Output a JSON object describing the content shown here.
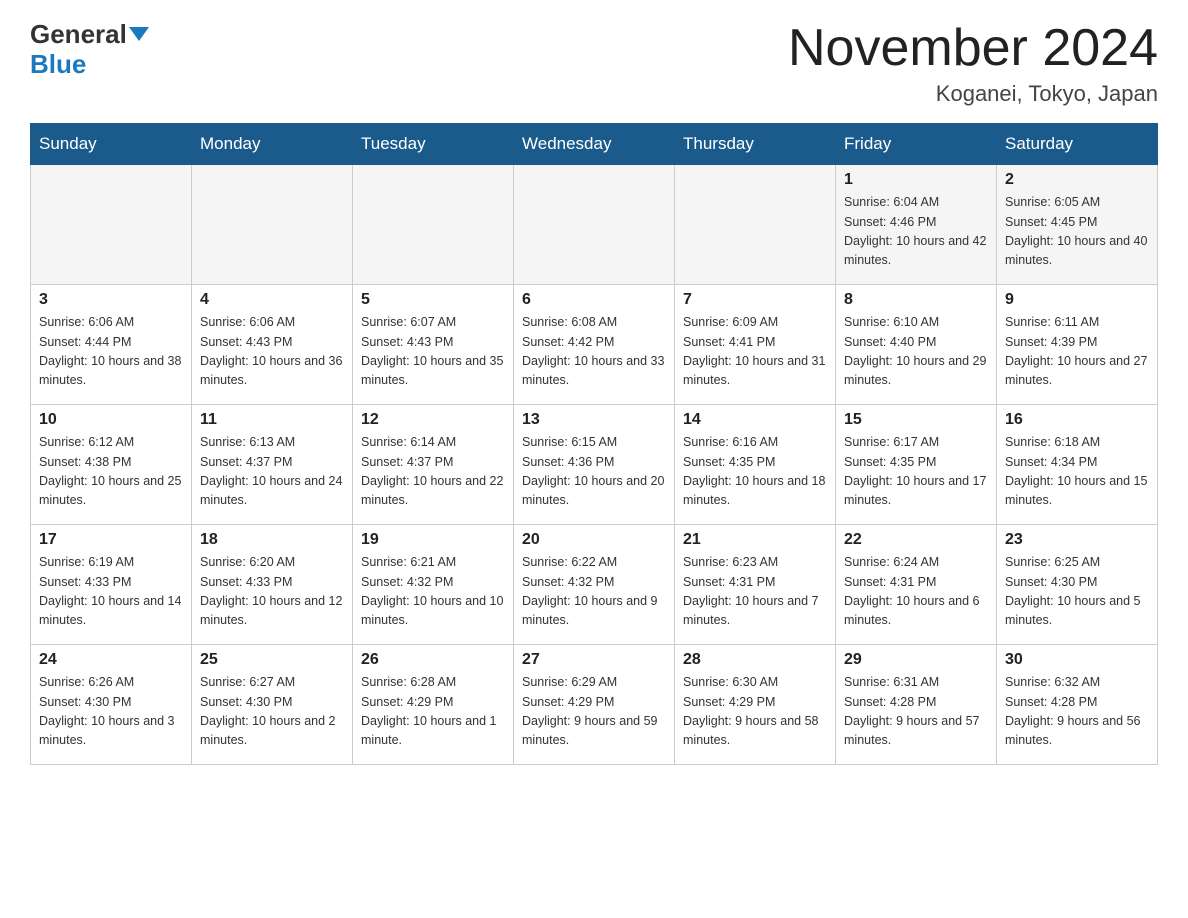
{
  "header": {
    "logo_line1": "General",
    "logo_line2": "Blue",
    "month": "November 2024",
    "location": "Koganei, Tokyo, Japan"
  },
  "weekdays": [
    "Sunday",
    "Monday",
    "Tuesday",
    "Wednesday",
    "Thursday",
    "Friday",
    "Saturday"
  ],
  "weeks": [
    [
      {
        "day": "",
        "sunrise": "",
        "sunset": "",
        "daylight": ""
      },
      {
        "day": "",
        "sunrise": "",
        "sunset": "",
        "daylight": ""
      },
      {
        "day": "",
        "sunrise": "",
        "sunset": "",
        "daylight": ""
      },
      {
        "day": "",
        "sunrise": "",
        "sunset": "",
        "daylight": ""
      },
      {
        "day": "",
        "sunrise": "",
        "sunset": "",
        "daylight": ""
      },
      {
        "day": "1",
        "sunrise": "Sunrise: 6:04 AM",
        "sunset": "Sunset: 4:46 PM",
        "daylight": "Daylight: 10 hours and 42 minutes."
      },
      {
        "day": "2",
        "sunrise": "Sunrise: 6:05 AM",
        "sunset": "Sunset: 4:45 PM",
        "daylight": "Daylight: 10 hours and 40 minutes."
      }
    ],
    [
      {
        "day": "3",
        "sunrise": "Sunrise: 6:06 AM",
        "sunset": "Sunset: 4:44 PM",
        "daylight": "Daylight: 10 hours and 38 minutes."
      },
      {
        "day": "4",
        "sunrise": "Sunrise: 6:06 AM",
        "sunset": "Sunset: 4:43 PM",
        "daylight": "Daylight: 10 hours and 36 minutes."
      },
      {
        "day": "5",
        "sunrise": "Sunrise: 6:07 AM",
        "sunset": "Sunset: 4:43 PM",
        "daylight": "Daylight: 10 hours and 35 minutes."
      },
      {
        "day": "6",
        "sunrise": "Sunrise: 6:08 AM",
        "sunset": "Sunset: 4:42 PM",
        "daylight": "Daylight: 10 hours and 33 minutes."
      },
      {
        "day": "7",
        "sunrise": "Sunrise: 6:09 AM",
        "sunset": "Sunset: 4:41 PM",
        "daylight": "Daylight: 10 hours and 31 minutes."
      },
      {
        "day": "8",
        "sunrise": "Sunrise: 6:10 AM",
        "sunset": "Sunset: 4:40 PM",
        "daylight": "Daylight: 10 hours and 29 minutes."
      },
      {
        "day": "9",
        "sunrise": "Sunrise: 6:11 AM",
        "sunset": "Sunset: 4:39 PM",
        "daylight": "Daylight: 10 hours and 27 minutes."
      }
    ],
    [
      {
        "day": "10",
        "sunrise": "Sunrise: 6:12 AM",
        "sunset": "Sunset: 4:38 PM",
        "daylight": "Daylight: 10 hours and 25 minutes."
      },
      {
        "day": "11",
        "sunrise": "Sunrise: 6:13 AM",
        "sunset": "Sunset: 4:37 PM",
        "daylight": "Daylight: 10 hours and 24 minutes."
      },
      {
        "day": "12",
        "sunrise": "Sunrise: 6:14 AM",
        "sunset": "Sunset: 4:37 PM",
        "daylight": "Daylight: 10 hours and 22 minutes."
      },
      {
        "day": "13",
        "sunrise": "Sunrise: 6:15 AM",
        "sunset": "Sunset: 4:36 PM",
        "daylight": "Daylight: 10 hours and 20 minutes."
      },
      {
        "day": "14",
        "sunrise": "Sunrise: 6:16 AM",
        "sunset": "Sunset: 4:35 PM",
        "daylight": "Daylight: 10 hours and 18 minutes."
      },
      {
        "day": "15",
        "sunrise": "Sunrise: 6:17 AM",
        "sunset": "Sunset: 4:35 PM",
        "daylight": "Daylight: 10 hours and 17 minutes."
      },
      {
        "day": "16",
        "sunrise": "Sunrise: 6:18 AM",
        "sunset": "Sunset: 4:34 PM",
        "daylight": "Daylight: 10 hours and 15 minutes."
      }
    ],
    [
      {
        "day": "17",
        "sunrise": "Sunrise: 6:19 AM",
        "sunset": "Sunset: 4:33 PM",
        "daylight": "Daylight: 10 hours and 14 minutes."
      },
      {
        "day": "18",
        "sunrise": "Sunrise: 6:20 AM",
        "sunset": "Sunset: 4:33 PM",
        "daylight": "Daylight: 10 hours and 12 minutes."
      },
      {
        "day": "19",
        "sunrise": "Sunrise: 6:21 AM",
        "sunset": "Sunset: 4:32 PM",
        "daylight": "Daylight: 10 hours and 10 minutes."
      },
      {
        "day": "20",
        "sunrise": "Sunrise: 6:22 AM",
        "sunset": "Sunset: 4:32 PM",
        "daylight": "Daylight: 10 hours and 9 minutes."
      },
      {
        "day": "21",
        "sunrise": "Sunrise: 6:23 AM",
        "sunset": "Sunset: 4:31 PM",
        "daylight": "Daylight: 10 hours and 7 minutes."
      },
      {
        "day": "22",
        "sunrise": "Sunrise: 6:24 AM",
        "sunset": "Sunset: 4:31 PM",
        "daylight": "Daylight: 10 hours and 6 minutes."
      },
      {
        "day": "23",
        "sunrise": "Sunrise: 6:25 AM",
        "sunset": "Sunset: 4:30 PM",
        "daylight": "Daylight: 10 hours and 5 minutes."
      }
    ],
    [
      {
        "day": "24",
        "sunrise": "Sunrise: 6:26 AM",
        "sunset": "Sunset: 4:30 PM",
        "daylight": "Daylight: 10 hours and 3 minutes."
      },
      {
        "day": "25",
        "sunrise": "Sunrise: 6:27 AM",
        "sunset": "Sunset: 4:30 PM",
        "daylight": "Daylight: 10 hours and 2 minutes."
      },
      {
        "day": "26",
        "sunrise": "Sunrise: 6:28 AM",
        "sunset": "Sunset: 4:29 PM",
        "daylight": "Daylight: 10 hours and 1 minute."
      },
      {
        "day": "27",
        "sunrise": "Sunrise: 6:29 AM",
        "sunset": "Sunset: 4:29 PM",
        "daylight": "Daylight: 9 hours and 59 minutes."
      },
      {
        "day": "28",
        "sunrise": "Sunrise: 6:30 AM",
        "sunset": "Sunset: 4:29 PM",
        "daylight": "Daylight: 9 hours and 58 minutes."
      },
      {
        "day": "29",
        "sunrise": "Sunrise: 6:31 AM",
        "sunset": "Sunset: 4:28 PM",
        "daylight": "Daylight: 9 hours and 57 minutes."
      },
      {
        "day": "30",
        "sunrise": "Sunrise: 6:32 AM",
        "sunset": "Sunset: 4:28 PM",
        "daylight": "Daylight: 9 hours and 56 minutes."
      }
    ]
  ]
}
